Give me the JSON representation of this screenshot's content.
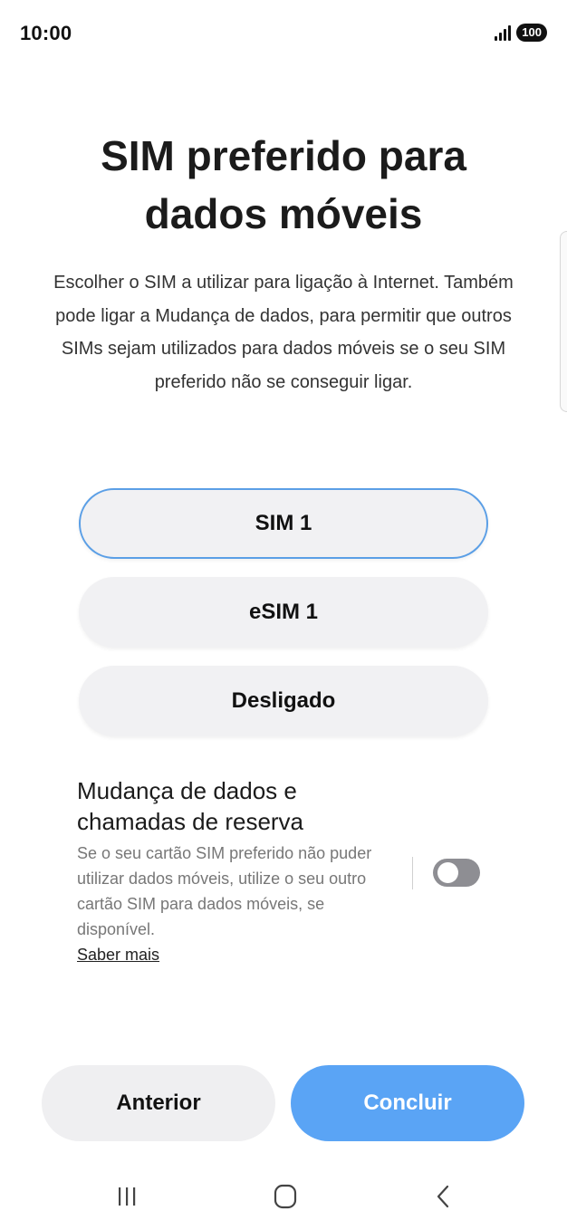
{
  "status_bar": {
    "time": "10:00",
    "battery": "100"
  },
  "page": {
    "title": "SIM preferido para dados móveis",
    "description": "Escolher o SIM a utilizar para ligação à Internet. Também pode ligar a Mudança de dados, para permitir que outros SIMs sejam utilizados para dados móveis se o seu SIM preferido não se conseguir ligar."
  },
  "options": [
    {
      "label": "SIM 1",
      "selected": true
    },
    {
      "label": "eSIM 1",
      "selected": false
    },
    {
      "label": "Desligado",
      "selected": false
    }
  ],
  "setting": {
    "title": "Mudança de dados e chamadas de reserva",
    "description": "Se o seu cartão SIM preferido não puder utilizar dados móveis, utilize o seu outro cartão SIM para dados móveis, se disponível.",
    "learn_more": "Saber mais",
    "toggle_on": false
  },
  "buttons": {
    "back": "Anterior",
    "done": "Concluir"
  },
  "colors": {
    "accent": "#5aa4f5",
    "selected_border": "#5b9fe6",
    "toggle_off": "#8e8e93"
  },
  "nav_icons": [
    "recents-icon",
    "home-icon",
    "back-icon"
  ]
}
